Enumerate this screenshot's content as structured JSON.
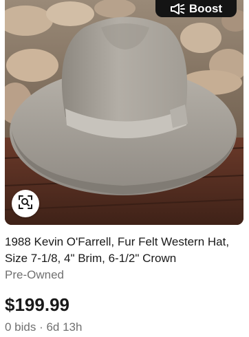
{
  "listing": {
    "boost_label": "Boost",
    "title": "1988 Kevin O'Farrell, Fur Felt Western Hat, Size 7-1/8, 4\" Brim, 6-1/2\" Crown",
    "condition": "Pre-Owned",
    "price": "$199.99",
    "bids_time": "0 bids · 6d 13h"
  },
  "icons": {
    "boost": "megaphone-icon",
    "visual_search": "visual-search-icon"
  },
  "colors": {
    "boost_bg": "#141414",
    "title_text": "#191919",
    "secondary_text": "#707070",
    "hat_felt": "#a9a49c"
  }
}
